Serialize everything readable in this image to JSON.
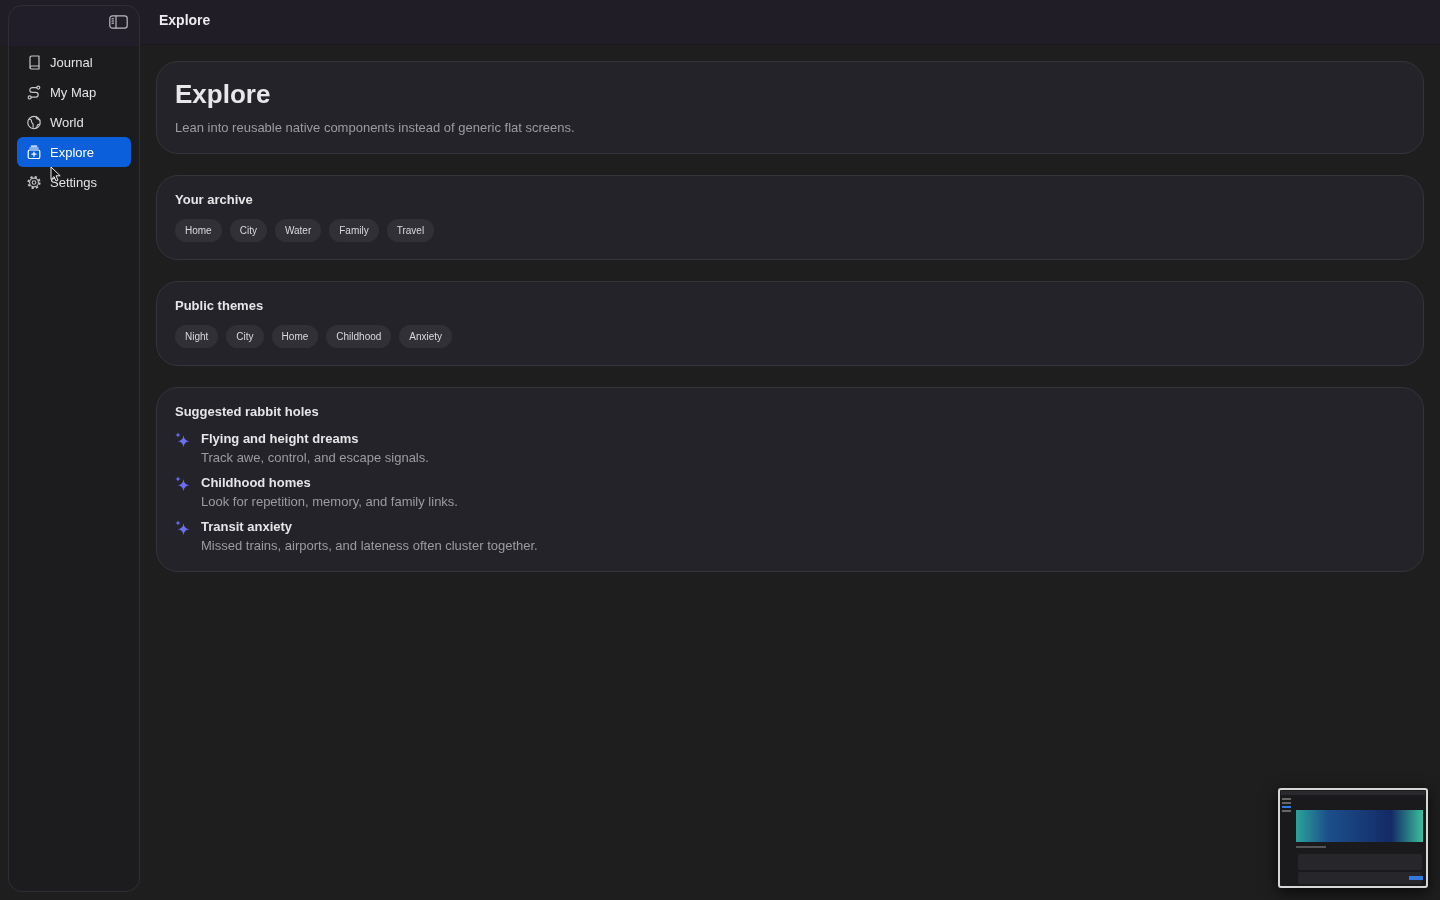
{
  "window": {
    "title": "Explore"
  },
  "sidebar": {
    "items": [
      {
        "label": "Journal",
        "selected": false
      },
      {
        "label": "My Map",
        "selected": false
      },
      {
        "label": "World",
        "selected": false
      },
      {
        "label": "Explore",
        "selected": true
      },
      {
        "label": "Settings",
        "selected": false
      }
    ]
  },
  "intro": {
    "title": "Explore",
    "subtitle": "Lean into reusable native components instead of generic flat screens."
  },
  "sections": [
    {
      "kind": "chips",
      "title": "Your archive",
      "chips": [
        "Home",
        "City",
        "Water",
        "Family",
        "Travel"
      ]
    },
    {
      "kind": "chips",
      "title": "Public themes",
      "chips": [
        "Night",
        "City",
        "Home",
        "Childhood",
        "Anxiety"
      ]
    },
    {
      "kind": "list",
      "title": "Suggested rabbit holes",
      "items": [
        {
          "title": "Flying and height dreams",
          "description": "Track awe, control, and escape signals."
        },
        {
          "title": "Childhood homes",
          "description": "Look for repetition, memory, and family links."
        },
        {
          "title": "Transit anxiety",
          "description": "Missed trains, airports, and lateness often cluster together."
        }
      ]
    }
  ]
}
